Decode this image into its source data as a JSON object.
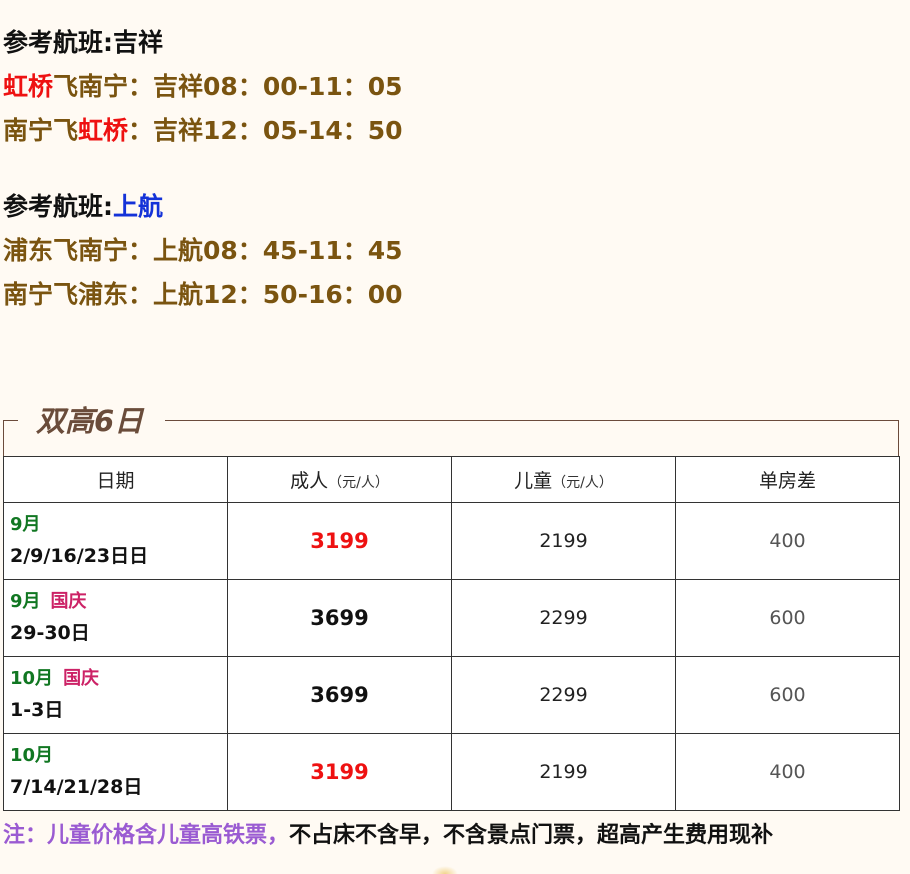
{
  "flights": [
    {
      "ref_label": "参考航班:",
      "airline": "吉祥",
      "airline_color": "#111111",
      "routes": [
        {
          "from": "虹桥",
          "to": "飞南宁",
          "detail": "：吉祥08：00-11：05",
          "from_red": true
        },
        {
          "from": "南宁飞",
          "to": "虹桥",
          "detail": "：吉祥12：05-14：50",
          "from_red": false
        }
      ]
    },
    {
      "ref_label": "参考航班:",
      "airline": "上航",
      "airline_color": "#1432d8",
      "routes": [
        {
          "text": "浦东飞南宁：上航08：45-11：45"
        },
        {
          "text": "南宁飞浦东：上航12：50-16：00"
        }
      ]
    }
  ],
  "section_title": "双高6日",
  "table": {
    "headers": {
      "date": "日期",
      "adult": "成人",
      "adult_unit": "（元/人）",
      "child": "儿童",
      "child_unit": "（元/人）",
      "single": "单房差"
    },
    "rows": [
      {
        "month": "9月",
        "holiday": "",
        "days": "2/9/16/23日日",
        "adult": "3199",
        "child": "2199",
        "single": "400"
      },
      {
        "month": "9月",
        "holiday": "国庆",
        "days": "29-30日",
        "adult": "3699",
        "child": "2299",
        "single": "600"
      },
      {
        "month": "10月",
        "holiday": "国庆",
        "days": "1-3日",
        "adult": "3699",
        "child": "2299",
        "single": "600"
      },
      {
        "month": "10月",
        "holiday": "",
        "days": "7/14/21/28日",
        "adult": "3199",
        "child": "2199",
        "single": "400"
      }
    ]
  },
  "note": {
    "purple": "注：儿童价格含儿童高铁票，",
    "black": "不占床不含早，不含景点门票，超高产生费用现补"
  },
  "colors": {
    "red": "#ee1111",
    "brown": "#7a5410",
    "blue": "#1432d8",
    "green": "#117722",
    "holiday": "#cc2266",
    "purple": "#9a5bd2",
    "background": "#fffaf3"
  }
}
